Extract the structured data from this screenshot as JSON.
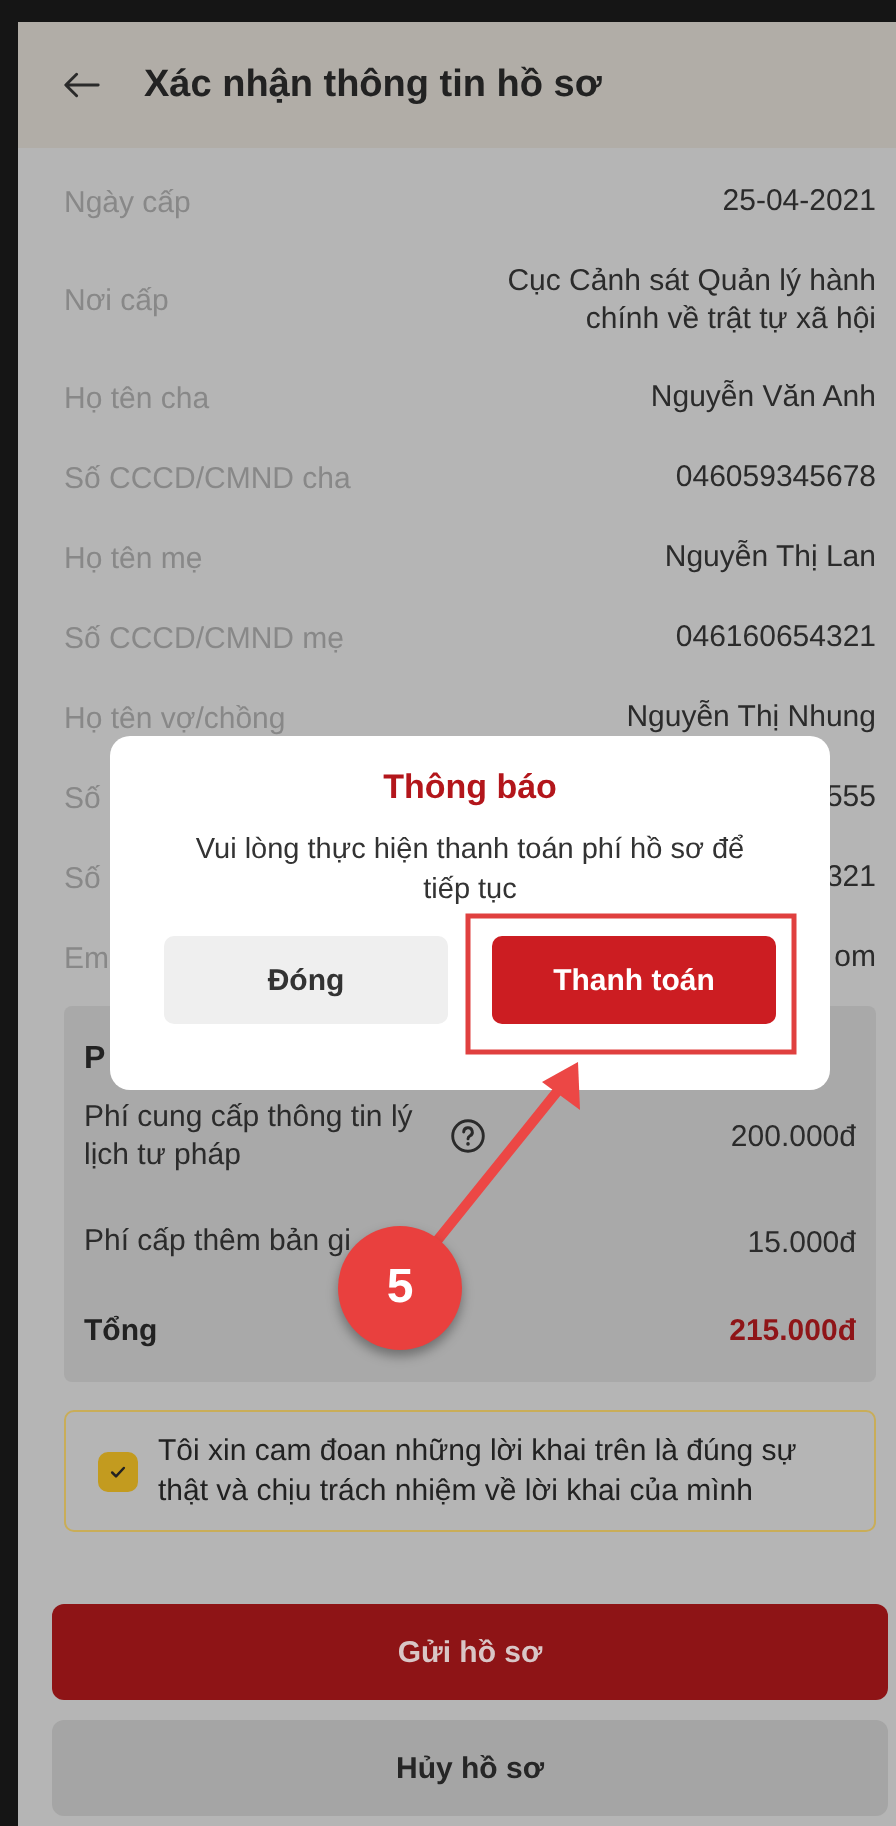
{
  "header": {
    "title": "Xác nhận thông tin hồ sơ"
  },
  "details": [
    {
      "label": "Ngày cấp",
      "value": "25-04-2021"
    },
    {
      "label": "Nơi cấp",
      "value": "Cục Cảnh sát Quản lý hành chính về trật tự xã hội"
    },
    {
      "label": "Họ tên cha",
      "value": "Nguyễn Văn Anh"
    },
    {
      "label": "Số CCCD/CMND cha",
      "value": "046059345678"
    },
    {
      "label": "Họ tên mẹ",
      "value": "Nguyễn Thị Lan"
    },
    {
      "label": "Số CCCD/CMND mẹ",
      "value": "046160654321"
    },
    {
      "label": "Họ tên vợ/chồng",
      "value": "Nguyễn Thị Nhung"
    },
    {
      "label": "Số",
      "value": "555"
    },
    {
      "label": "Số",
      "value": "321"
    },
    {
      "label": "Em",
      "value": "om"
    }
  ],
  "fees": {
    "title": "P",
    "items": [
      {
        "label": "Phí cung cấp thông tin lý lịch tư pháp",
        "value": "200.000đ",
        "info": true
      },
      {
        "label": "Phí cấp thêm bản gi",
        "value": "15.000đ",
        "info": false
      }
    ],
    "total": {
      "label": "Tổng",
      "value": "215.000đ"
    }
  },
  "declaration": {
    "text": "Tôi xin cam đoan những lời khai trên là đúng sự thật và chịu trách nhiệm về lời khai của mình",
    "checked": true
  },
  "actions": [
    {
      "label": "Gửi hồ sơ",
      "kind": "primary"
    },
    {
      "label": "Hủy hồ sơ",
      "kind": "secondary"
    }
  ],
  "dialog": {
    "title": "Thông báo",
    "message": "Vui lòng thực hiện thanh toán phí hồ sơ để tiếp tục",
    "buttons": [
      {
        "label": "Đóng",
        "kind": "secondary"
      },
      {
        "label": "Thanh toán",
        "kind": "primary"
      }
    ]
  },
  "annotation": {
    "step": "5"
  }
}
